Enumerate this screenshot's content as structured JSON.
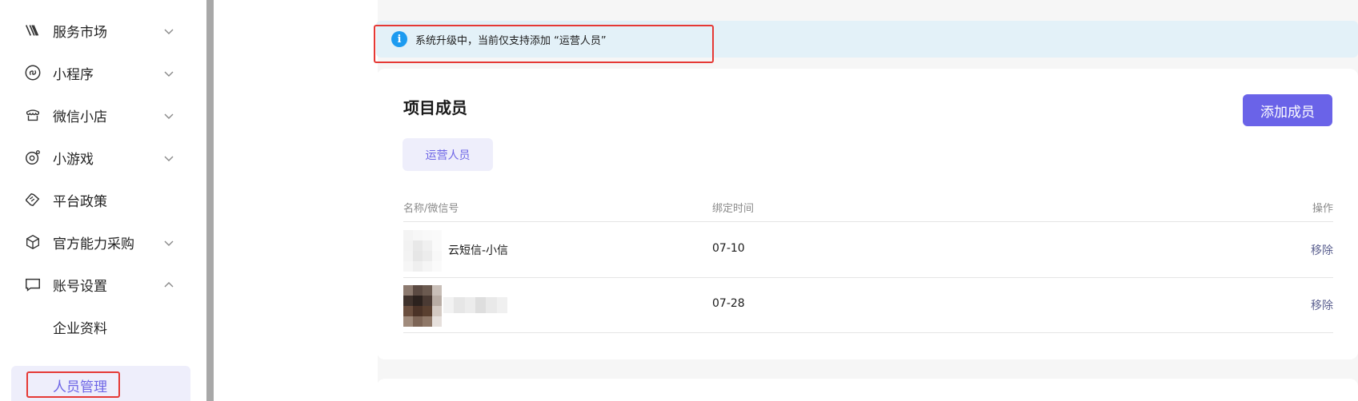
{
  "sidebar": {
    "items": [
      {
        "label": "服务市场",
        "icon": "service-market-icon"
      },
      {
        "label": "小程序",
        "icon": "mini-program-icon"
      },
      {
        "label": "微信小店",
        "icon": "store-icon"
      },
      {
        "label": "小游戏",
        "icon": "mini-game-icon"
      },
      {
        "label": "平台政策",
        "icon": "policy-icon"
      },
      {
        "label": "官方能力采购",
        "icon": "purchase-icon"
      },
      {
        "label": "账号设置",
        "icon": "chat-bubble-icon"
      }
    ],
    "sub_items": [
      {
        "label": "企业资料"
      },
      {
        "label": "人员管理"
      }
    ]
  },
  "notice": {
    "text": "系统升级中，当前仅支持添加 “运营人员”"
  },
  "card": {
    "title": "项目成员",
    "add_button": "添加成员",
    "role_tab": "运营人员",
    "columns": [
      "名称/微信号",
      "绑定时间",
      "操作"
    ],
    "rows": [
      {
        "name": "云短信-小信",
        "time": "07-10",
        "action": "移除"
      },
      {
        "name": "",
        "time": "07-28",
        "action": "移除"
      }
    ]
  },
  "colors": {
    "accent": "#6a63e8",
    "info": "#1d9bf0",
    "highlight_box": "#e53935"
  }
}
